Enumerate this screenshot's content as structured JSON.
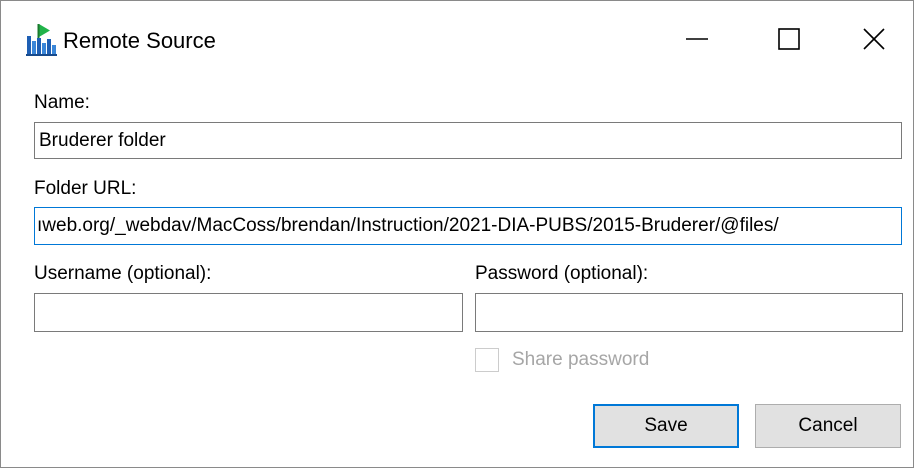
{
  "window": {
    "title": "Remote Source"
  },
  "form": {
    "name_label": "Name:",
    "name_value": "Bruderer folder",
    "folder_url_label": "Folder URL:",
    "folder_url_value": "ıweb.org/_webdav/MacCoss/brendan/Instruction/2021-DIA-PUBS/2015-Bruderer/@files/",
    "username_label": "Username (optional):",
    "username_value": "",
    "password_label": "Password (optional):",
    "password_value": "",
    "share_password_label": "Share password",
    "share_password_checked": false,
    "share_password_enabled": false
  },
  "buttons": {
    "save": "Save",
    "cancel": "Cancel"
  },
  "icons": {
    "app": "skyline-panorama-icon",
    "minimize": "minimize-icon",
    "maximize": "maximize-icon",
    "close": "close-icon"
  },
  "colors": {
    "focus_border": "#0078d7",
    "button_face": "#e1e1e1",
    "disabled_text": "#a6a6a6"
  }
}
